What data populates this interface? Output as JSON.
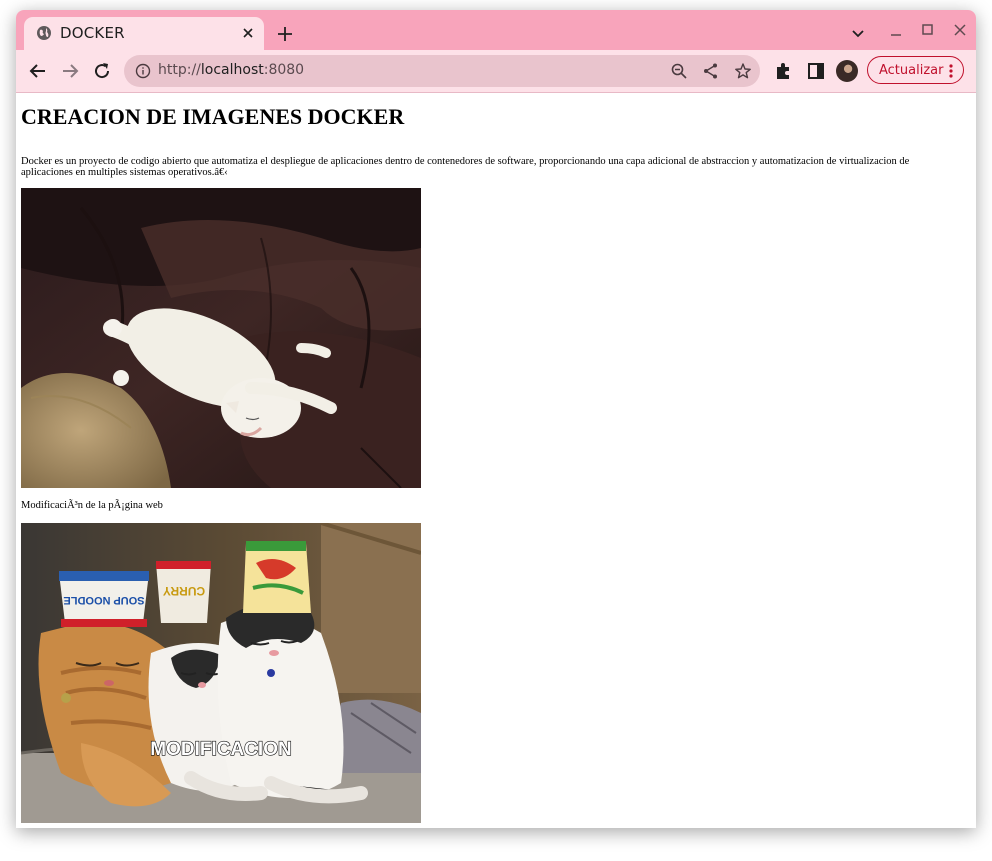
{
  "browser": {
    "tab_title": "DOCKER",
    "url_scheme": "http://",
    "url_host": "localhost",
    "url_port": ":8080",
    "update_label": "Actualizar",
    "theme_color": "#f8a4bb",
    "accent_color": "#c0102c",
    "icons": [
      "globe-icon",
      "close-icon",
      "plus-icon",
      "chevron-down-icon",
      "minimize-icon",
      "maximize-icon",
      "back-icon",
      "forward-icon",
      "reload-icon",
      "info-icon",
      "zoom-icon",
      "share-icon",
      "star-icon",
      "extensions-icon",
      "side-panel-icon",
      "kebab-menu-icon"
    ]
  },
  "page": {
    "heading": "CREACION DE IMAGENES DOCKER",
    "description": "Docker es un proyecto de codigo abierto que automatiza el despliegue de aplicaciones dentro de contenedores de software, proporcionando una capa adicional de abstraccion y automatizacion de virtualizacion de aplicaciones en multiples sistemas operativos.â€‹",
    "image1_subject": "white cat sleeping on a brown leather couch",
    "caption": "ModificaciÃ³n de la pÃ¡gina web",
    "image2_subject": "three cats wearing instant noodle cups as hats",
    "image2_overlay_text": "MODIFICACION",
    "cup_labels": [
      "SOUP NOODLE",
      "CURRY"
    ]
  }
}
